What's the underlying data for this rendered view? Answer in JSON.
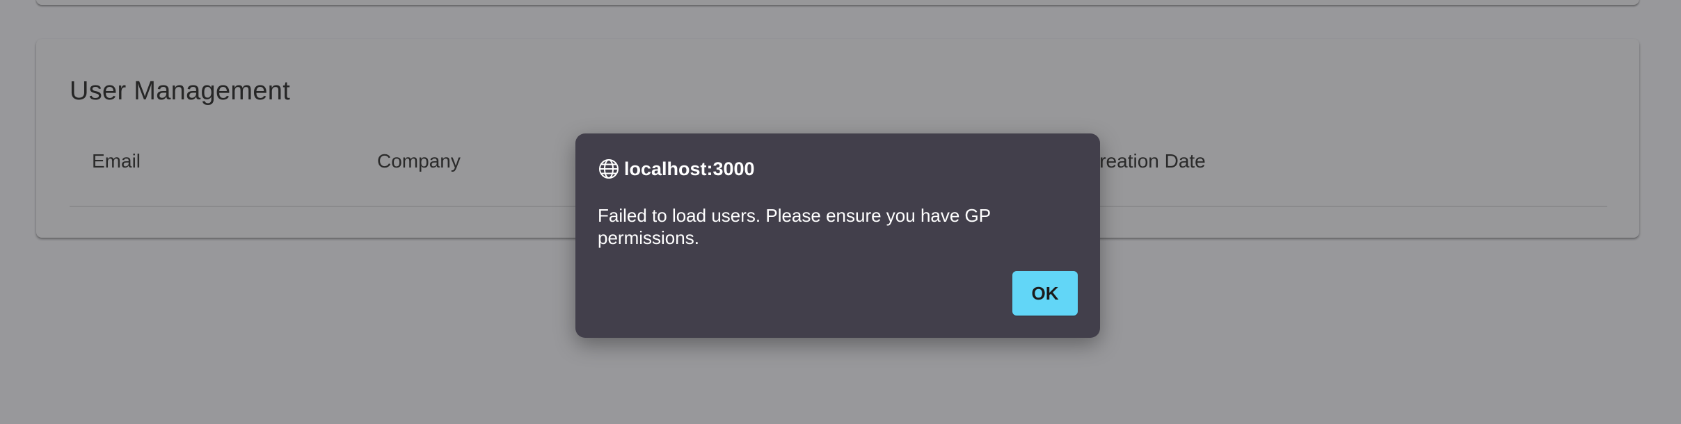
{
  "panel": {
    "title": "User Management",
    "columns": [
      "Email",
      "Company",
      "Creation Date"
    ]
  },
  "dialog": {
    "origin": "localhost:3000",
    "origin_icon": "globe-icon",
    "message": "Failed to load users. Please ensure you have GP permissions.",
    "ok_label": "OK"
  },
  "colors": {
    "backdrop": "#98989b",
    "dialog_bg": "#423f4b",
    "ok_button": "#62d6f7"
  }
}
